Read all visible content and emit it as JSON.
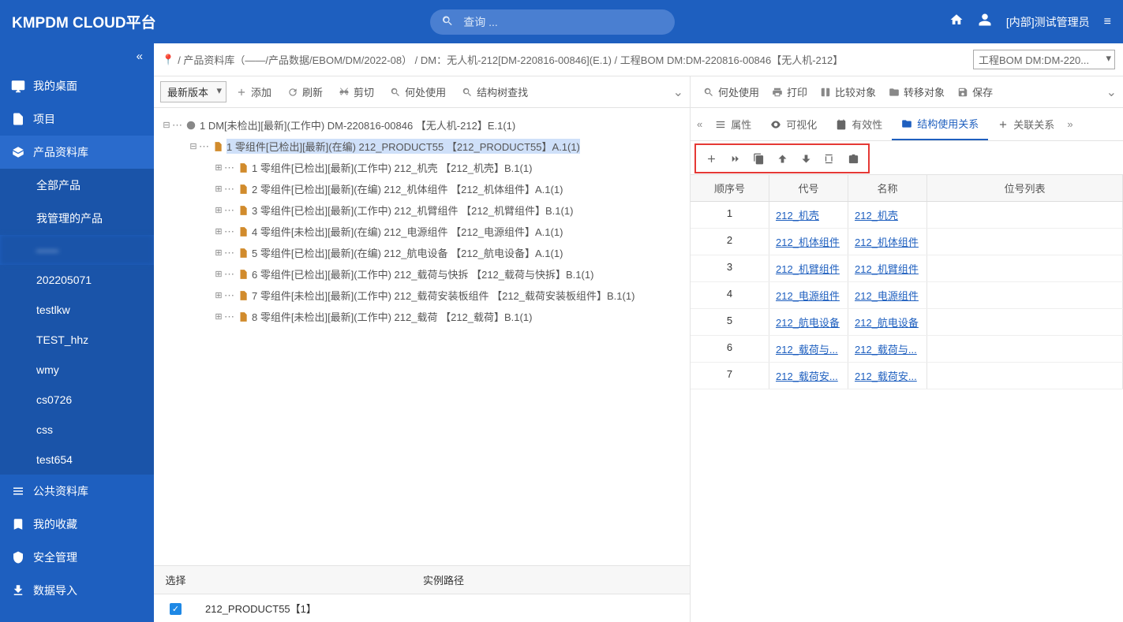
{
  "app": {
    "title": "KMPDM CLOUD平台"
  },
  "search": {
    "placeholder": "查询 ..."
  },
  "user": {
    "label": "[内部]测试管理员"
  },
  "sidebar": {
    "items": [
      {
        "label": "我的桌面"
      },
      {
        "label": "项目"
      },
      {
        "label": "产品资料库"
      },
      {
        "label": "公共资料库"
      },
      {
        "label": "我的收藏"
      },
      {
        "label": "安全管理"
      },
      {
        "label": "数据导入"
      }
    ],
    "subs": [
      {
        "label": "全部产品"
      },
      {
        "label": "我管理的产品"
      },
      {
        "label": "——"
      },
      {
        "label": "202205071"
      },
      {
        "label": "testlkw"
      },
      {
        "label": "TEST_hhz"
      },
      {
        "label": "wmy"
      },
      {
        "label": "cs0726"
      },
      {
        "label": "css"
      },
      {
        "label": "test654"
      }
    ]
  },
  "breadcrumb": {
    "full": "/ 产品资料库（——/产品数据/EBOM/DM/2022-08） / DM：无人机-212[DM-220816-00846](E.1) / 工程BOM DM:DM-220816-00846【无人机-212】",
    "selector": "工程BOM DM:DM-220..."
  },
  "leftToolbar": {
    "version": "最新版本",
    "btns": [
      "添加",
      "刷新",
      "剪切",
      "何处使用",
      "结构树查找"
    ]
  },
  "tree": {
    "root": "1 DM[未检出][最新](工作中) DM-220816-00846 【无人机-212】E.1(1)",
    "sel": "1 零组件[已检出][最新](在编) 212_PRODUCT55 【212_PRODUCT55】A.1(1)",
    "rows": [
      "1 零组件[已检出][最新](工作中) 212_机壳 【212_机壳】B.1(1)",
      "2 零组件[已检出][最新](在编) 212_机体组件 【212_机体组件】A.1(1)",
      "3 零组件[已检出][最新](工作中) 212_机臂组件 【212_机臂组件】B.1(1)",
      "4 零组件[未检出][最新](在编) 212_电源组件 【212_电源组件】A.1(1)",
      "5 零组件[已检出][最新](在编) 212_航电设备 【212_航电设备】A.1(1)",
      "6 零组件[已检出][最新](工作中) 212_载荷与快拆 【212_载荷与快拆】B.1(1)",
      "7 零组件[未检出][最新](工作中) 212_载荷安装板组件 【212_载荷安装板组件】B.1(1)",
      "8 零组件[未检出][最新](工作中) 212_载荷 【212_载荷】B.1(1)"
    ]
  },
  "instance": {
    "headers": [
      "选择",
      "实例路径"
    ],
    "row": "212_PRODUCT55【1】"
  },
  "rightToolbar": {
    "btns": [
      "何处使用",
      "打印",
      "比较对象",
      "转移对象",
      "保存"
    ]
  },
  "tabs": [
    "属性",
    "可视化",
    "有效性",
    "结构使用关系",
    "关联关系"
  ],
  "grid": {
    "headers": [
      "顺序号",
      "代号",
      "名称",
      "位号列表"
    ],
    "rows": [
      {
        "n": "1",
        "code": "212_机壳",
        "name": "212_机壳"
      },
      {
        "n": "2",
        "code": "212_机体组件",
        "name": "212_机体组件"
      },
      {
        "n": "3",
        "code": "212_机臂组件",
        "name": "212_机臂组件"
      },
      {
        "n": "4",
        "code": "212_电源组件",
        "name": "212_电源组件"
      },
      {
        "n": "5",
        "code": "212_航电设备",
        "name": "212_航电设备"
      },
      {
        "n": "6",
        "code": "212_载荷与...",
        "name": "212_载荷与..."
      },
      {
        "n": "7",
        "code": "212_载荷安...",
        "name": "212_载荷安..."
      }
    ]
  }
}
